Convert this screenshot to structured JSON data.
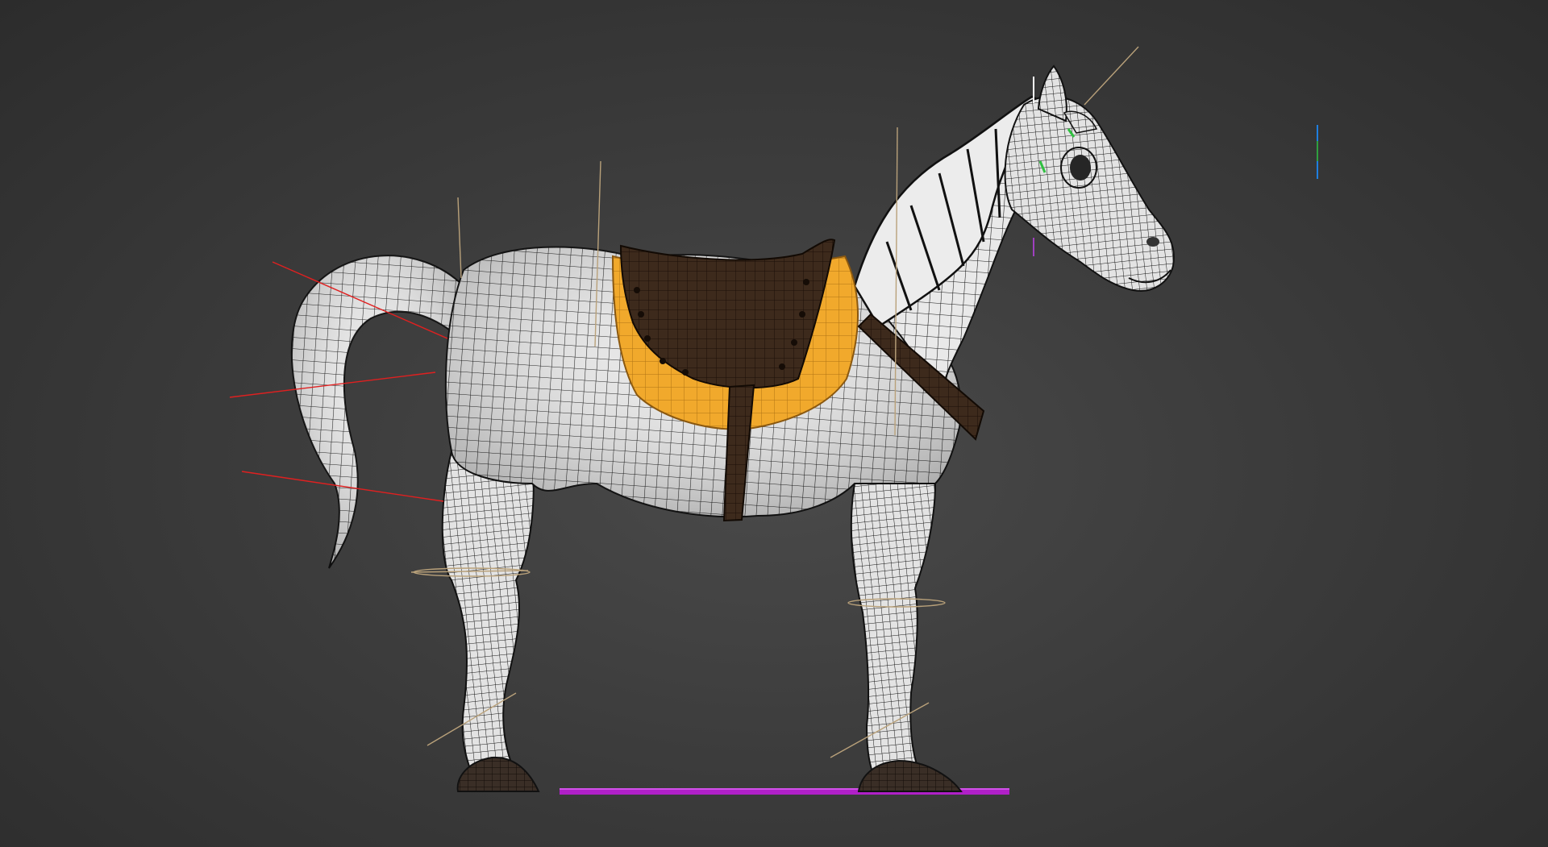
{
  "viewport": {
    "background_center": "#4a4a4a",
    "background_edge": "#2c2c2c"
  },
  "model": {
    "subject": "horse-wireframe-model",
    "body_color": "#e9e9e9",
    "wire_color": "#111111",
    "saddle_color": "#3d2a1c",
    "saddle_pad_color": "#f1a92c",
    "strap_color": "#3a2618",
    "hoof_color": "#3a2e26"
  },
  "gizmos": {
    "bone_line_color": "#b9a17a",
    "tail_bone_color": "#e02020",
    "ground_plane_color": "#b020c8",
    "axis_marker_colors": [
      "#1e7fe0",
      "#2fa040"
    ]
  }
}
